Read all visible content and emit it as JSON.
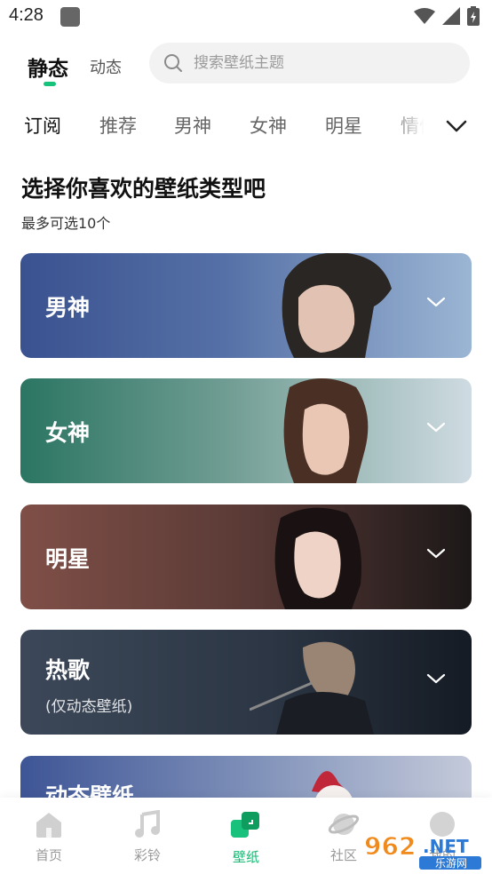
{
  "status_bar": {
    "time": "4:28"
  },
  "header": {
    "tab_static": "静态",
    "tab_dynamic": "动态",
    "search_placeholder": "搜索壁纸主题"
  },
  "categories": [
    "订阅",
    "推荐",
    "男神",
    "女神",
    "明星",
    "情侣"
  ],
  "page": {
    "title": "选择你喜欢的壁纸类型吧",
    "subtitle": "最多可选10个"
  },
  "cards": [
    {
      "title": "男神",
      "note": "",
      "color_from": "#3b5590",
      "color_to": "#8aa9cc"
    },
    {
      "title": "女神",
      "note": "",
      "color_from": "#2f7b6a",
      "color_to": "#c4d5dc"
    },
    {
      "title": "明星",
      "note": "",
      "color_from": "#7e5048",
      "color_to": "#1e1a1a"
    },
    {
      "title": "热歌",
      "note": "(仅动态壁纸)",
      "color_from": "#3d4a5a",
      "color_to": "#1c2430"
    },
    {
      "title": "动态壁纸",
      "note": "",
      "color_from": "#3e5596",
      "color_to": "#b7c0d4"
    }
  ],
  "bottom_nav": {
    "items": [
      {
        "label": "首页",
        "icon": "home-icon"
      },
      {
        "label": "彩铃",
        "icon": "music-note-icon"
      },
      {
        "label": "壁纸",
        "icon": "wallpaper-icon"
      },
      {
        "label": "社区",
        "icon": "planet-icon"
      },
      {
        "label": "我的",
        "icon": "profile-icon"
      }
    ]
  },
  "watermark": {
    "text": "962.NET",
    "sub": "乐游网"
  },
  "colors": {
    "accent": "#17c37b",
    "text": "#111111",
    "muted": "#999999"
  }
}
